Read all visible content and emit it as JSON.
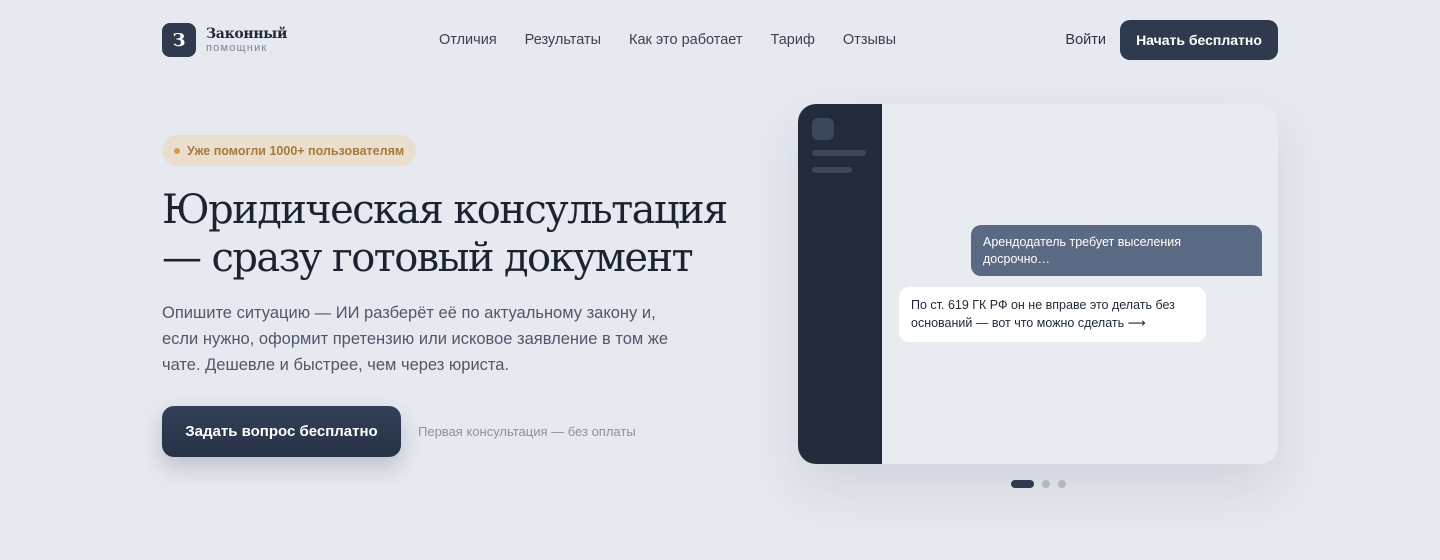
{
  "header": {
    "logo_letter": "З",
    "logo_title": "Законный",
    "logo_subtitle": "помощник",
    "nav": [
      "Отличия",
      "Результаты",
      "Как это работает",
      "Тариф",
      "Отзывы"
    ],
    "login": "Войти",
    "start": "Начать бесплатно"
  },
  "hero": {
    "badge": "Уже помогли 1000+ пользователям",
    "title": "Юридическая консультация — сразу готовый документ",
    "description": "Опишите ситуацию — ИИ разберёт её по актуальному закону и, если нужно, оформит претензию или исковое заявление в том же чате. Дешевле и быстрее, чем через юриста.",
    "cta": "Задать вопрос бесплатно",
    "cta_note": "Первая консультация — без оплаты"
  },
  "mock": {
    "user_message": "Арендодатель требует выселения досрочно…",
    "bot_message": "По ст. 619 ГК РФ он не вправе это делать без оснований — вот что можно сделать ⟶"
  },
  "carousel": {
    "slides": 3,
    "active": 1
  },
  "colors": {
    "primary": "#2f3a4e",
    "background": "#e6e9f0",
    "badge": "#eadfcf",
    "accent": "#a77a3a"
  }
}
